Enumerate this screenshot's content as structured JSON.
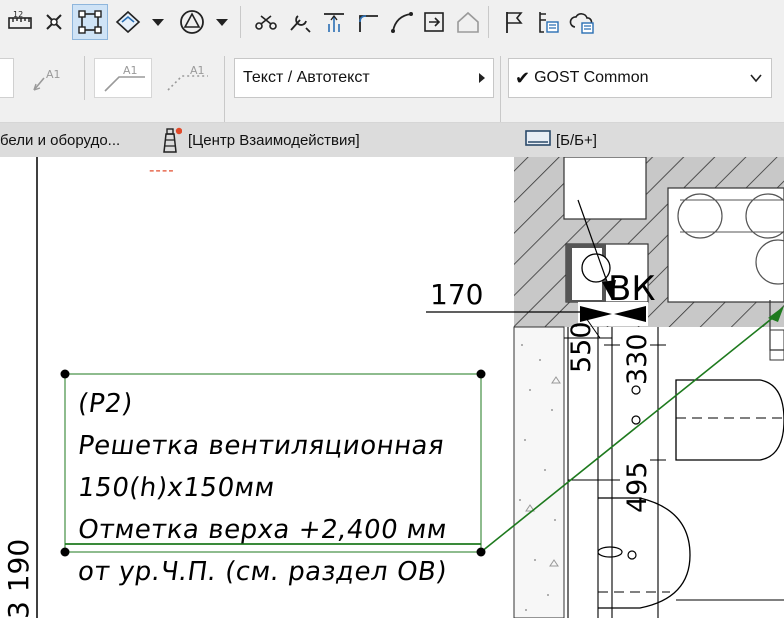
{
  "toolbar": {
    "text_style_combo": "Текст / Автотекст",
    "font_combo": "GOST Common",
    "label_tool_text": "A1"
  },
  "tabs": [
    {
      "label": "бели и оборудо..."
    },
    {
      "label": "[Центр Взаимодействия]"
    },
    {
      "label": "[Б/Б+]"
    }
  ],
  "drawing": {
    "label_lines": [
      "(P2)",
      "Решетка вентиляционная",
      "150(h)x150мм",
      "Отметка верха +2,400 мм",
      "от ур.Ч.П. (см. раздел ОВ)"
    ],
    "dim_170": "170",
    "dim_550": "550",
    "dim_330": "330",
    "dim_495": "495",
    "dim_3190": "3 190",
    "tag_vk": "ВК",
    "notify_dashes": "----"
  },
  "colors": {
    "accent": "#1e7a1e",
    "notify": "#e24a2a",
    "hatch_fill": "#c8c8c8"
  }
}
